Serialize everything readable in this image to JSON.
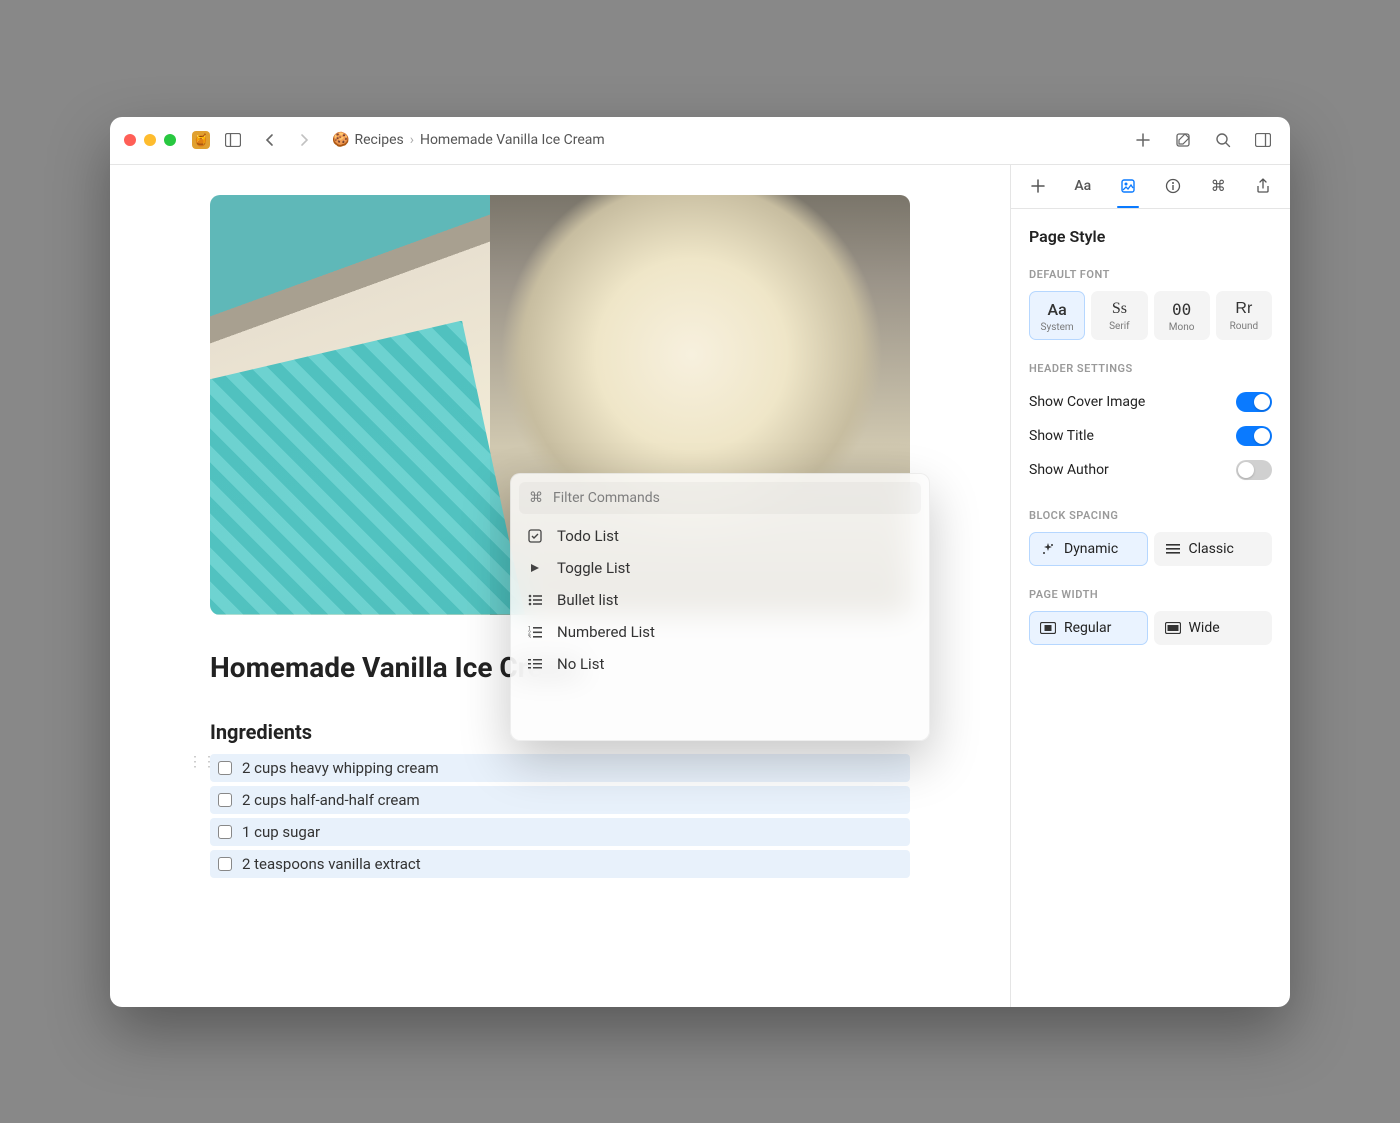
{
  "toolbar": {
    "breadcrumb": {
      "parent_icon": "🍪",
      "parent_label": "Recipes",
      "current_label": "Homemade Vanilla Ice Cream"
    }
  },
  "document": {
    "title": "Homemade Vanilla Ice Cream",
    "sections": {
      "ingredients": {
        "heading": "Ingredients",
        "items": [
          "2 cups heavy whipping cream",
          "2 cups half-and-half cream",
          "1 cup sugar",
          "2 teaspoons vanilla extract"
        ]
      }
    }
  },
  "command_palette": {
    "search_icon": "⌘",
    "placeholder": "Filter Commands",
    "items": [
      {
        "icon": "todo",
        "label": "Todo List"
      },
      {
        "icon": "toggle",
        "label": "Toggle List"
      },
      {
        "icon": "bullet",
        "label": "Bullet list"
      },
      {
        "icon": "numbered",
        "label": "Numbered List"
      },
      {
        "icon": "nolist",
        "label": "No List"
      }
    ]
  },
  "sidebar": {
    "title": "Page Style",
    "default_font": {
      "section_label": "Default Font",
      "options": [
        {
          "sample": "Aa",
          "label": "System",
          "selected": true
        },
        {
          "sample": "Ss",
          "label": "Serif"
        },
        {
          "sample": "00",
          "label": "Mono"
        },
        {
          "sample": "Rr",
          "label": "Round"
        }
      ]
    },
    "header_settings": {
      "section_label": "Header Settings",
      "rows": [
        {
          "label": "Show Cover Image",
          "on": true
        },
        {
          "label": "Show Title",
          "on": true
        },
        {
          "label": "Show Author",
          "on": false
        }
      ]
    },
    "block_spacing": {
      "section_label": "Block Spacing",
      "options": [
        {
          "label": "Dynamic",
          "selected": true
        },
        {
          "label": "Classic",
          "selected": false
        }
      ]
    },
    "page_width": {
      "section_label": "Page Width",
      "options": [
        {
          "label": "Regular",
          "selected": true
        },
        {
          "label": "Wide",
          "selected": false
        }
      ]
    }
  }
}
